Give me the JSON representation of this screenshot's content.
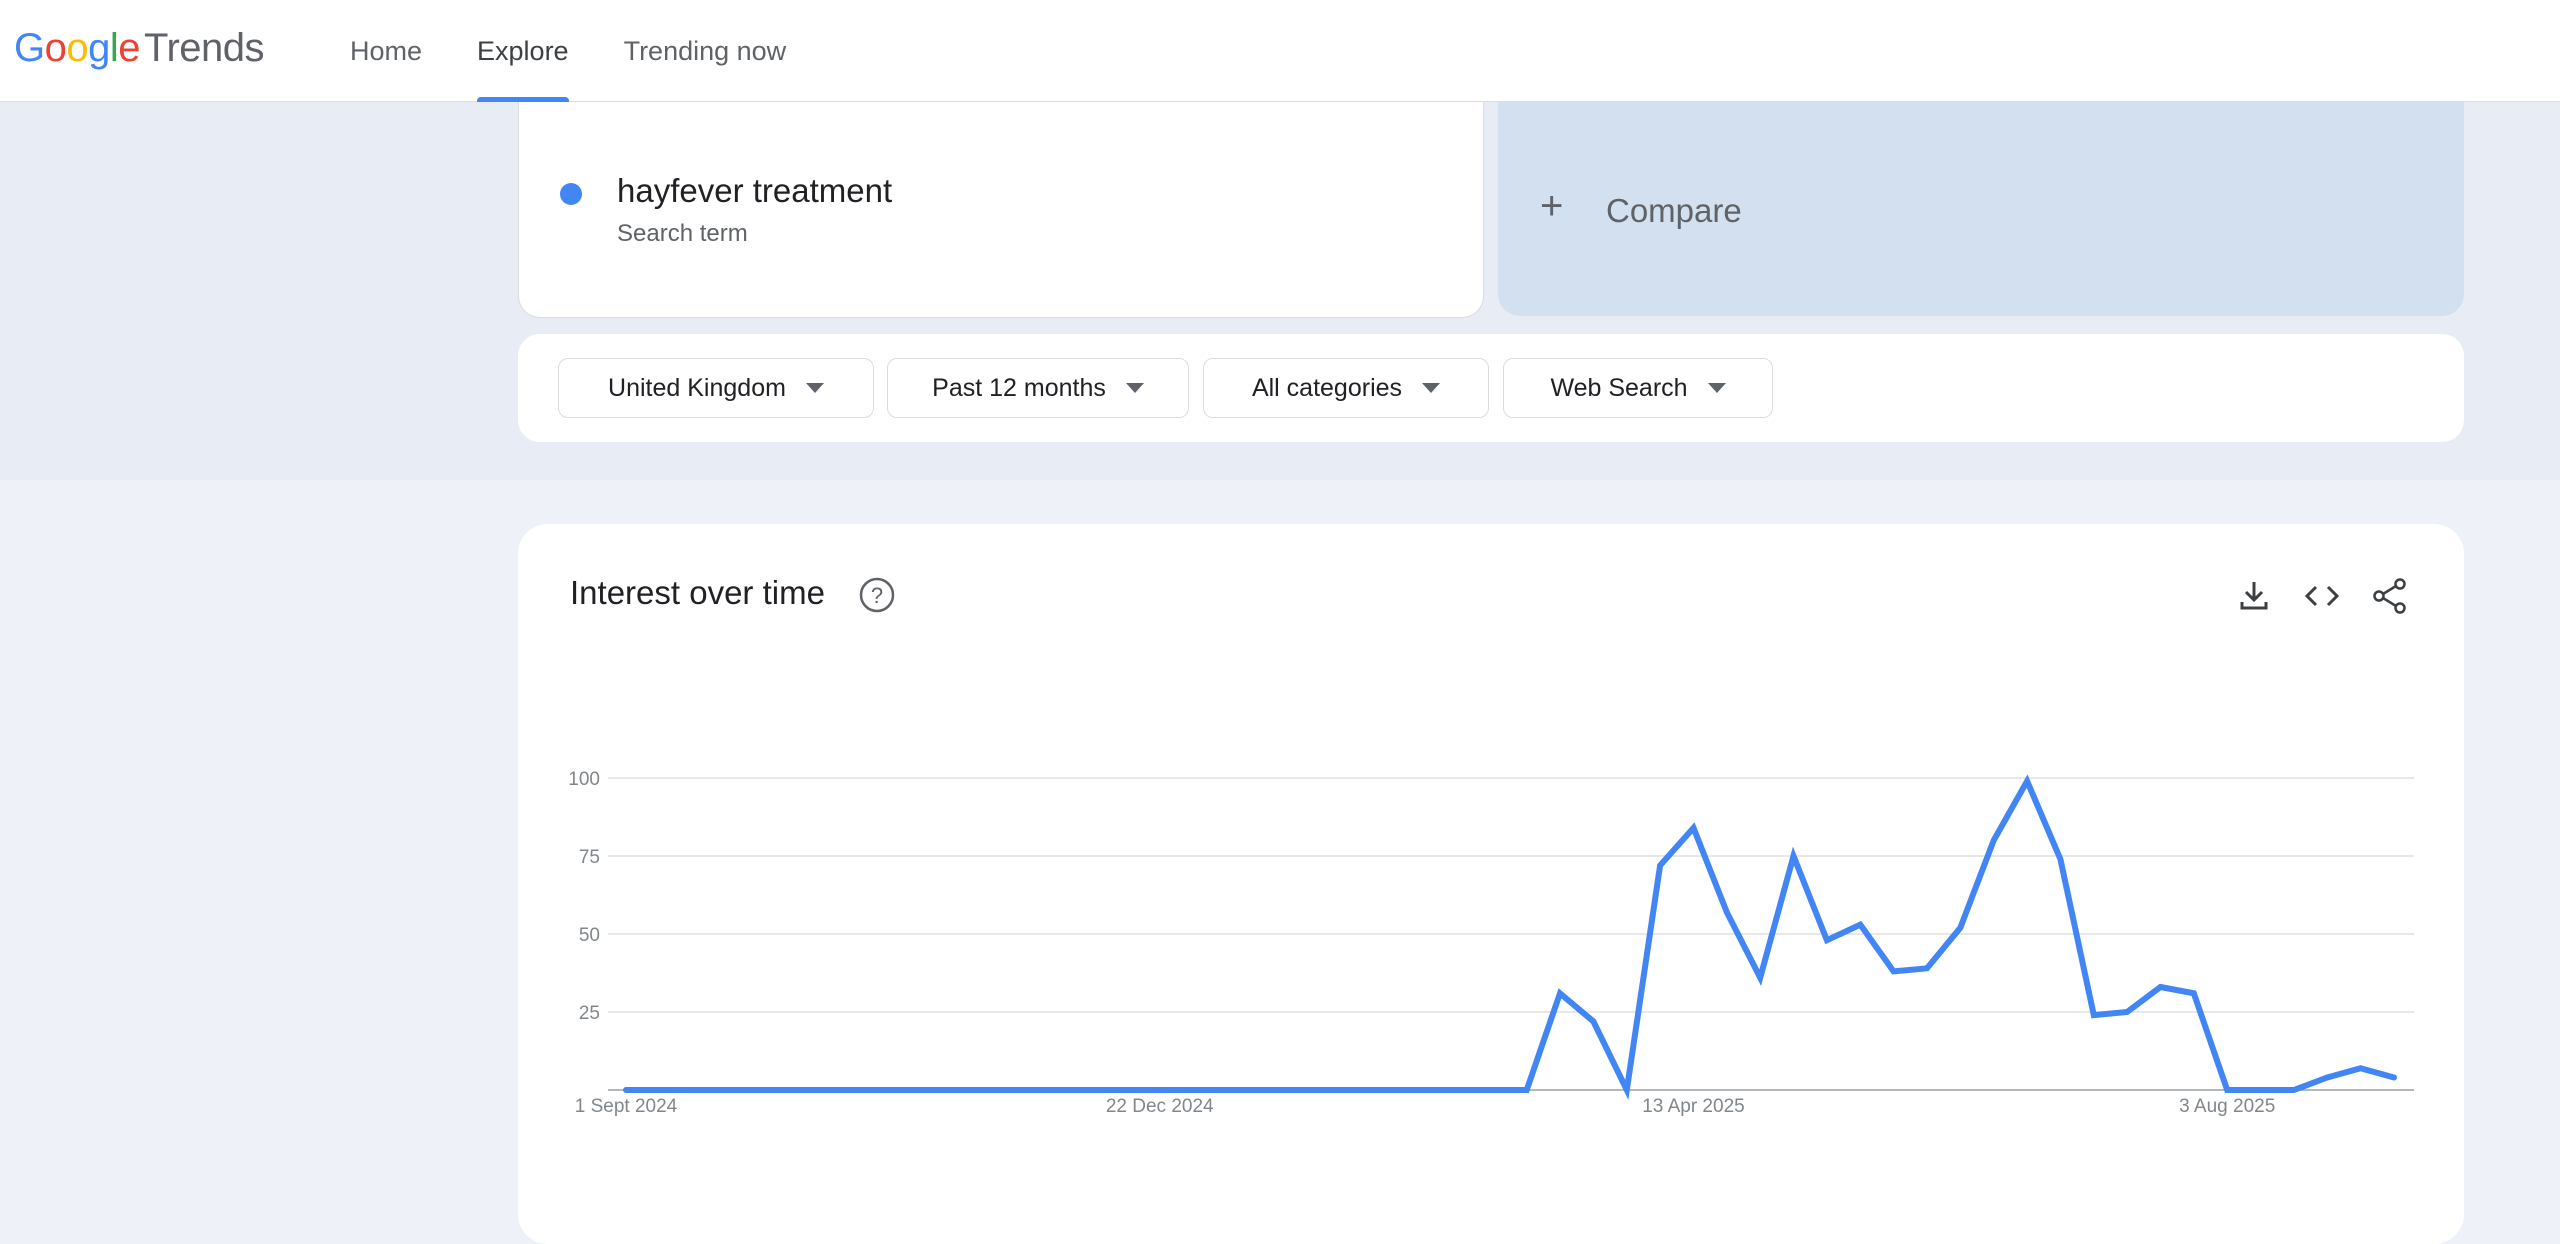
{
  "header": {
    "logo": {
      "google": "Google",
      "product": "Trends"
    },
    "nav": [
      {
        "label": "Home",
        "active": false
      },
      {
        "label": "Explore",
        "active": true
      },
      {
        "label": "Trending now",
        "active": false
      }
    ]
  },
  "search": {
    "term": "hayfever treatment",
    "term_type": "Search term",
    "term_color": "#4285f4",
    "compare_label": "Compare"
  },
  "filters": {
    "region": "United Kingdom",
    "period": "Past 12 months",
    "category": "All categories",
    "property": "Web Search"
  },
  "chart": {
    "title": "Interest over time",
    "icons": [
      "help-icon",
      "download-icon",
      "embed-code-icon",
      "share-icon"
    ]
  },
  "chart_data": {
    "type": "line",
    "title": "Interest over time",
    "ylim": [
      0,
      100
    ],
    "yticks": [
      25,
      50,
      75,
      100
    ],
    "x_tick_labels": [
      "1 Sept 2024",
      "22 Dec 2024",
      "13 Apr 2025",
      "3 Aug 2025"
    ],
    "grid": true,
    "series": [
      {
        "name": "hayfever treatment",
        "color": "#4285f4",
        "values": [
          0,
          0,
          0,
          0,
          0,
          0,
          0,
          0,
          0,
          0,
          0,
          0,
          0,
          0,
          0,
          0,
          0,
          0,
          0,
          0,
          0,
          0,
          0,
          0,
          0,
          0,
          0,
          0,
          31,
          22,
          0,
          72,
          84,
          57,
          36,
          75,
          48,
          53,
          38,
          39,
          52,
          80,
          99,
          74,
          24,
          25,
          33,
          31,
          0,
          0,
          0,
          4,
          7,
          4
        ]
      }
    ]
  }
}
